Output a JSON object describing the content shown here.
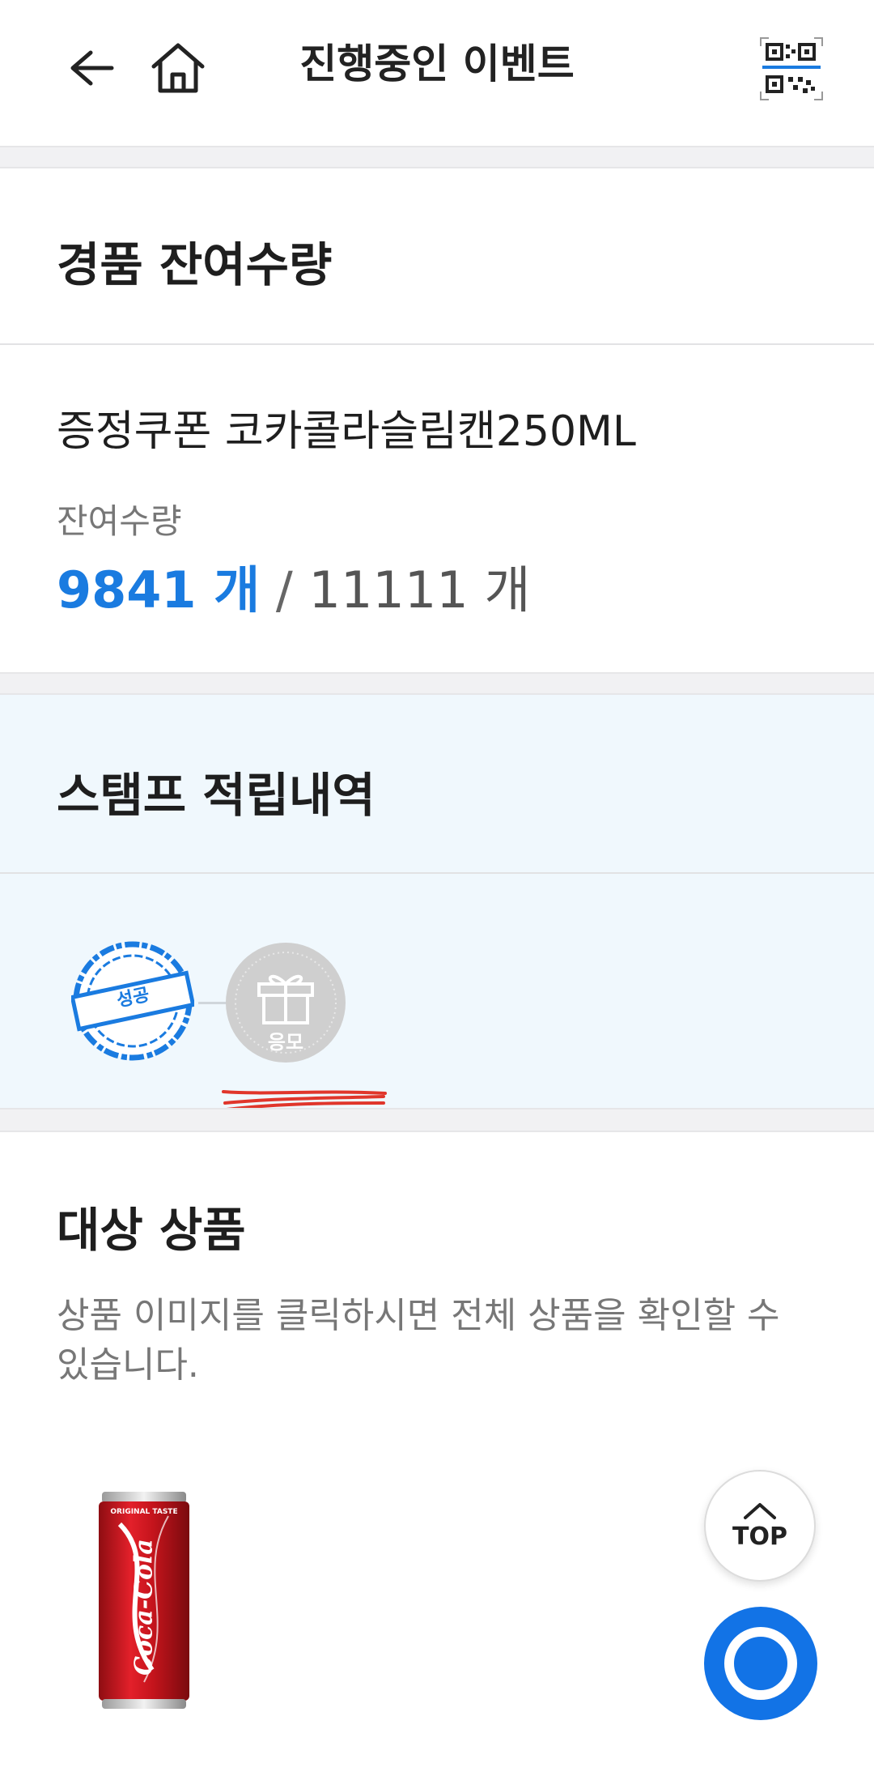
{
  "header": {
    "title": "진행중인 이벤트",
    "icons": [
      "back-arrow-icon",
      "home-icon",
      "qr-code-icon"
    ]
  },
  "prize": {
    "section_title": "경품 잔여수량",
    "name": "증정쿠폰 코카콜라슬림캔250ML",
    "remain_label": "잔여수량",
    "remain_current": "9841 개",
    "separator": "/",
    "remain_total": "11111 개"
  },
  "stamp": {
    "section_title": "스탬프 적립내역",
    "success_label": "성공",
    "apply_label": "응모",
    "accent_color": "#1a7be0"
  },
  "products": {
    "section_title": "대상 상품",
    "description": "상품 이미지를 클릭하시면 전체 상품을 확인할 수 있습니다.",
    "can_text": "Coca-Cola",
    "can_top_text": "ORIGINAL TASTE"
  },
  "floating": {
    "top_label": "TOP"
  }
}
